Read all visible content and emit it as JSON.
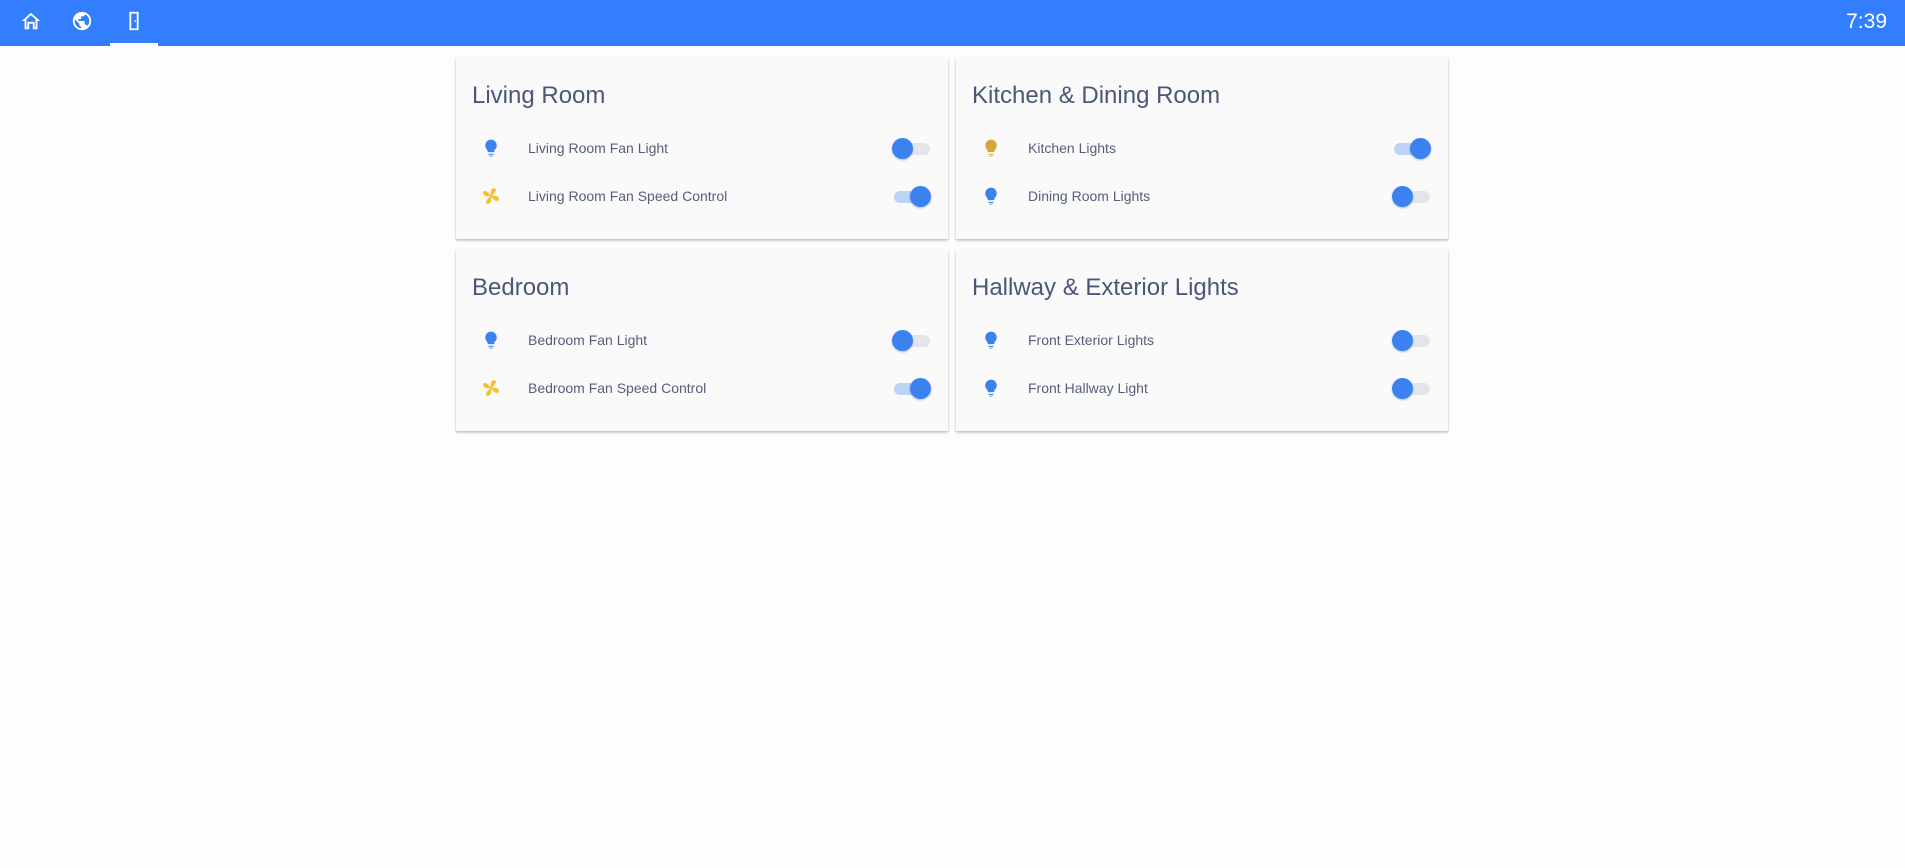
{
  "header": {
    "tabs": [
      {
        "icon": "home-icon",
        "active": false
      },
      {
        "icon": "globe-icon",
        "active": false
      },
      {
        "icon": "door-icon",
        "active": true
      }
    ],
    "clock": "7:39",
    "accent_color": "#327eff"
  },
  "cards": [
    {
      "title": "Living Room",
      "entities": [
        {
          "label": "Living Room Fan Light",
          "icon": "lightbulb-icon",
          "icon_color": "#3b82f0",
          "state": "off"
        },
        {
          "label": "Living Room Fan Speed Control",
          "icon": "fan-icon",
          "icon_color": "#f2c233",
          "state": "on"
        }
      ]
    },
    {
      "title": "Kitchen & Dining Room",
      "entities": [
        {
          "label": "Kitchen Lights",
          "icon": "lightbulb-icon",
          "icon_color": "#d4a73a",
          "state": "on"
        },
        {
          "label": "Dining Room Lights",
          "icon": "lightbulb-icon",
          "icon_color": "#3b82f0",
          "state": "off"
        }
      ]
    },
    {
      "title": "Bedroom",
      "entities": [
        {
          "label": "Bedroom Fan Light",
          "icon": "lightbulb-icon",
          "icon_color": "#3b82f0",
          "state": "off"
        },
        {
          "label": "Bedroom Fan Speed Control",
          "icon": "fan-icon",
          "icon_color": "#f2c233",
          "state": "on"
        }
      ]
    },
    {
      "title": "Hallway & Exterior Lights",
      "entities": [
        {
          "label": "Front Exterior Lights",
          "icon": "lightbulb-icon",
          "icon_color": "#3b82f0",
          "state": "off"
        },
        {
          "label": "Front Hallway Light",
          "icon": "lightbulb-icon",
          "icon_color": "#3b82f0",
          "state": "off"
        }
      ]
    }
  ]
}
